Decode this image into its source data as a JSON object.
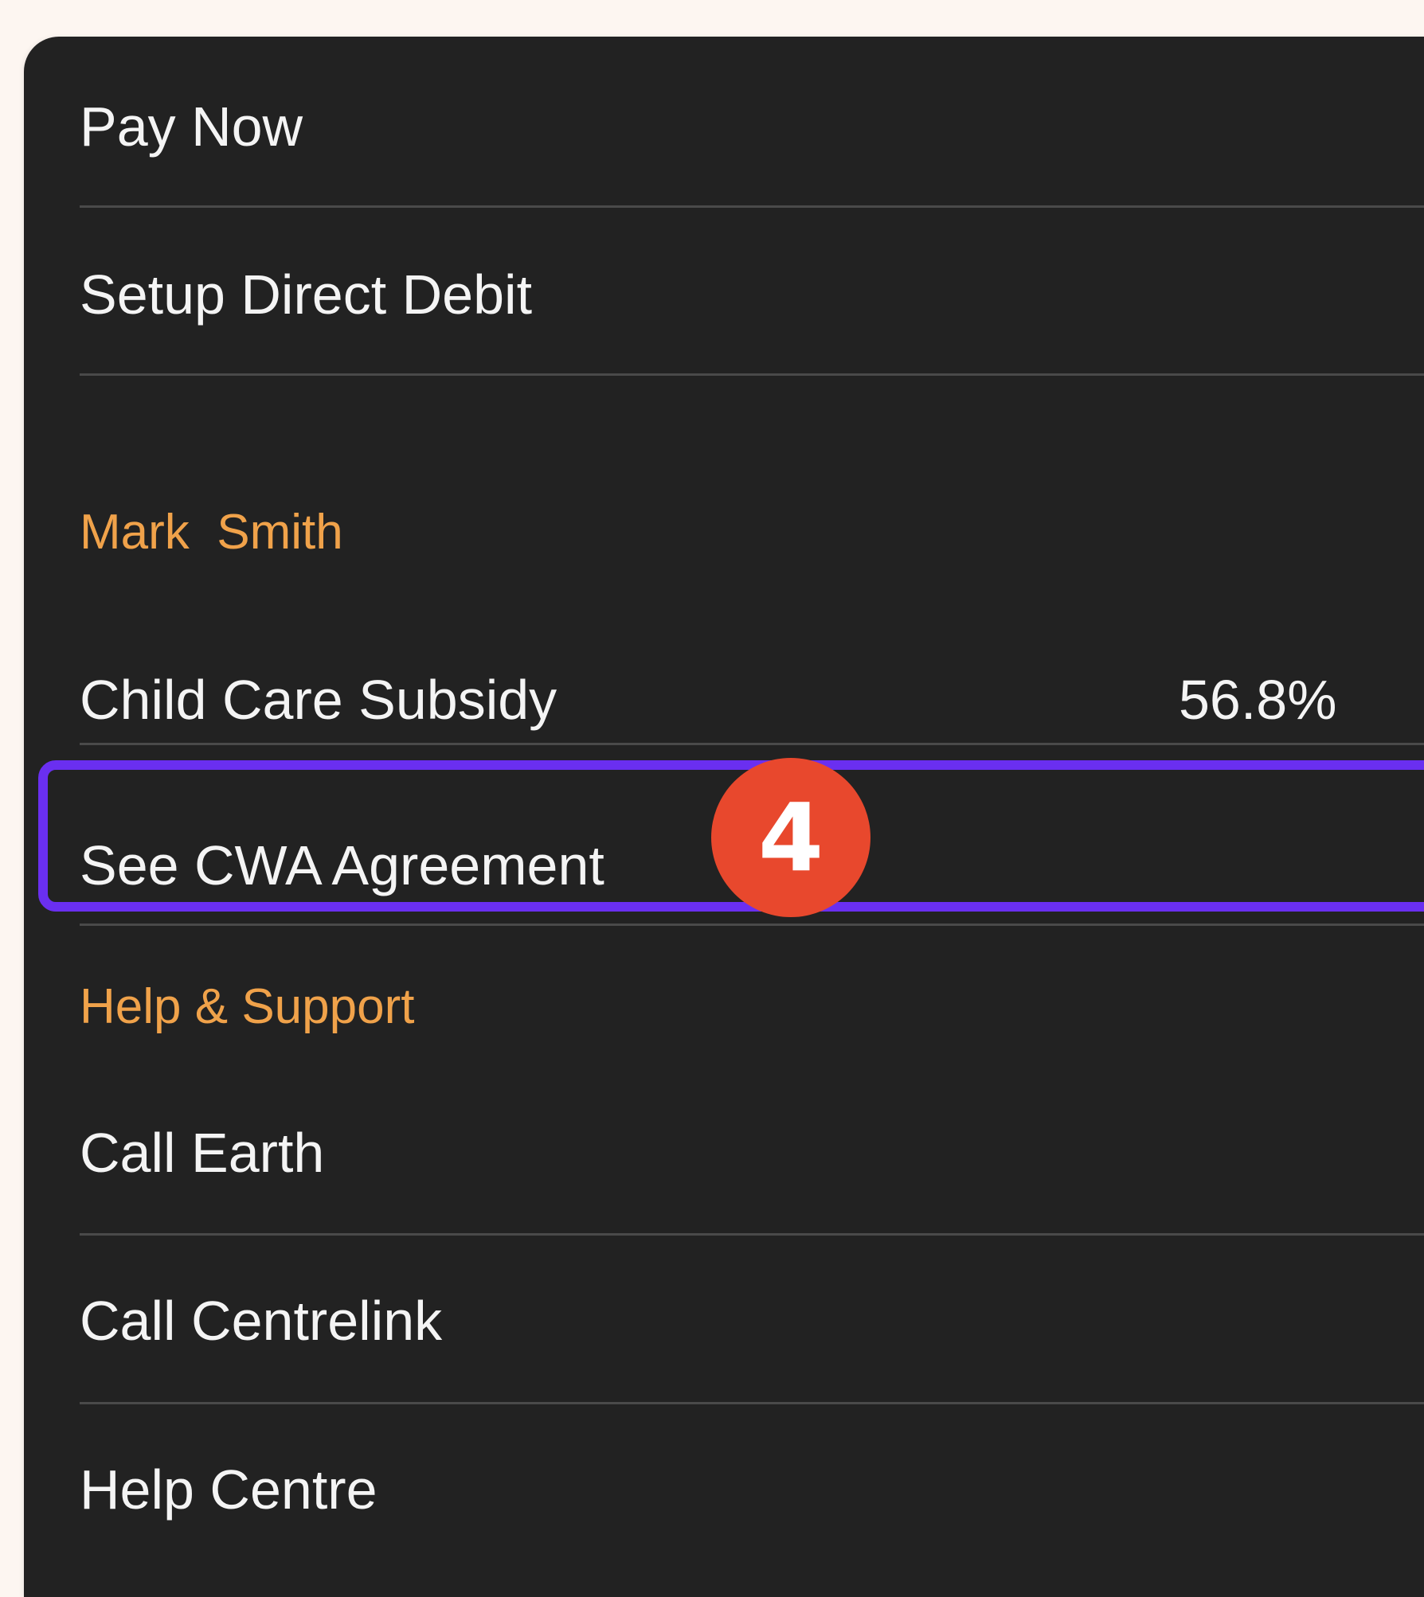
{
  "menu": {
    "items_top": [
      {
        "label": "Pay Now"
      },
      {
        "label": "Setup Direct Debit"
      }
    ],
    "account_section": {
      "header": "Mark  Smith",
      "subsidy_label": "Child Care Subsidy",
      "subsidy_value": "56.8%",
      "agreement_label": "See CWA Agreement"
    },
    "help_section": {
      "header": "Help & Support",
      "items": [
        {
          "label": "Call Earth"
        },
        {
          "label": "Call Centrelink"
        },
        {
          "label": "Help Centre"
        }
      ]
    }
  },
  "annotation": {
    "step_number": "4",
    "highlight_color": "#6a2ff0",
    "badge_color": "#e8482d"
  },
  "colors": {
    "page_background": "#fdf6f1",
    "panel_background": "#222222",
    "section_header": "#f0a24a",
    "item_text": "#f4f4f4"
  }
}
